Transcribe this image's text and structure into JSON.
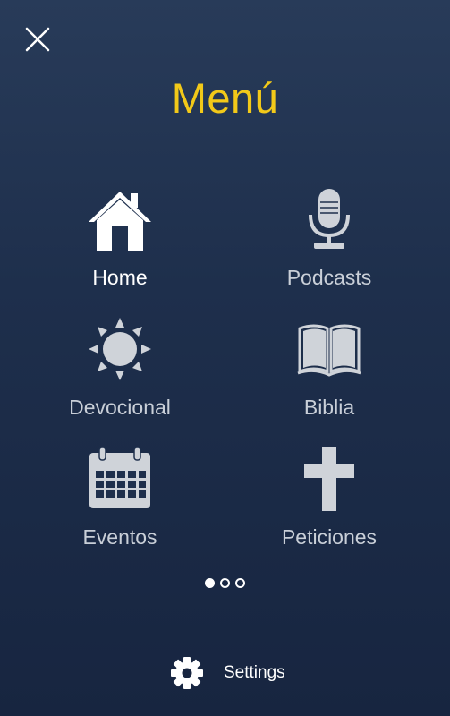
{
  "header": {
    "close_icon": "close-icon",
    "title": "Menú"
  },
  "menu": {
    "items": [
      {
        "label": "Home",
        "icon": "home-icon",
        "active": true
      },
      {
        "label": "Podcasts",
        "icon": "microphone-icon",
        "active": false
      },
      {
        "label": "Devocional",
        "icon": "sun-icon",
        "active": false
      },
      {
        "label": "Biblia",
        "icon": "open-book-icon",
        "active": false
      },
      {
        "label": "Eventos",
        "icon": "calendar-icon",
        "active": false
      },
      {
        "label": "Peticiones",
        "icon": "cross-icon",
        "active": false
      }
    ]
  },
  "pagination": {
    "current_page": 1,
    "total_pages": 3
  },
  "footer": {
    "settings_label": "Settings",
    "settings_icon": "gear-icon"
  },
  "colors": {
    "background_top": "#283b59",
    "background_bottom": "#172540",
    "title": "#f2c919",
    "icon": "#ffffff",
    "label": "#c9cfd8"
  }
}
